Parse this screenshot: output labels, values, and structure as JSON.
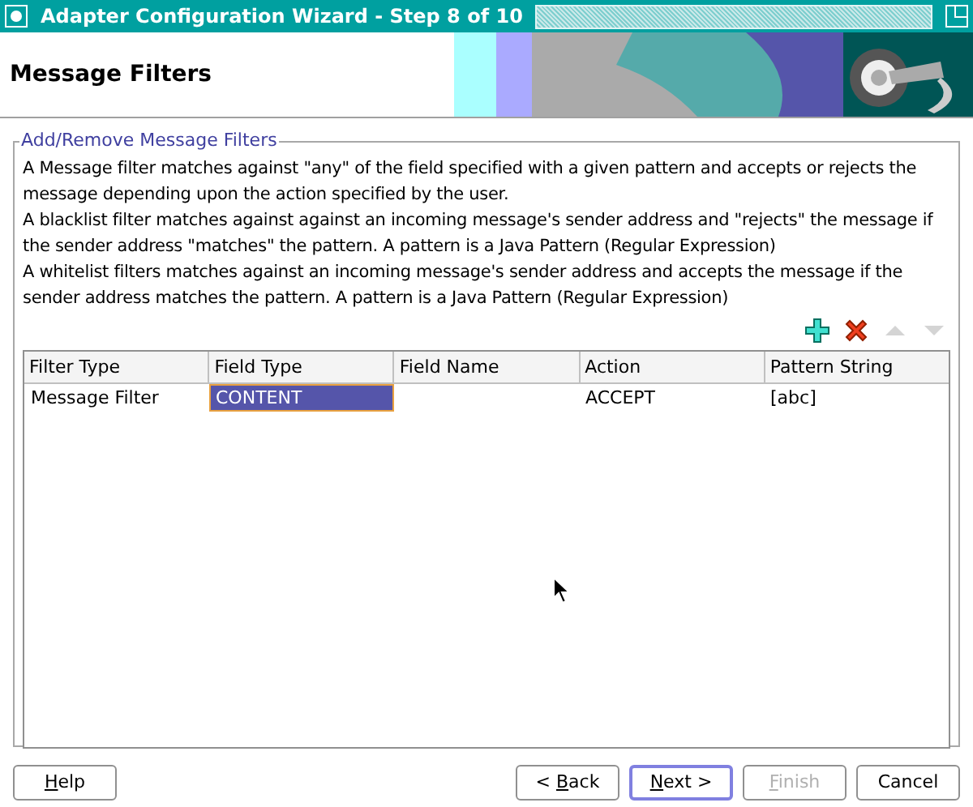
{
  "window": {
    "title": "Adapter Configuration Wizard - Step 8 of 10"
  },
  "header": {
    "title": "Message Filters"
  },
  "group": {
    "title": "Add/Remove Message Filters",
    "description": [
      "A Message filter matches against \"any\" of the field specified with a given pattern and accepts or rejects the message depending upon the action specified by the user.",
      "A blacklist filter matches against against an incoming message's sender address and \"rejects\" the message if the sender address \"matches\" the pattern. A pattern is a Java Pattern (Regular Expression)",
      "A whitelist filters matches against an incoming message's sender address and accepts the message if the sender address matches the pattern. A pattern is a Java Pattern (Regular Expression)"
    ],
    "toolbar": [
      {
        "kind": "add",
        "disabled": false
      },
      {
        "kind": "delete",
        "disabled": false
      },
      {
        "kind": "up",
        "disabled": true
      },
      {
        "kind": "down",
        "disabled": true
      }
    ],
    "table": {
      "columns": [
        "Filter Type",
        "Field Type",
        "Field Name",
        "Action",
        "Pattern String"
      ],
      "rows": [
        {
          "cells": [
            {
              "text": "Message Filter",
              "selected": false
            },
            {
              "text": "CONTENT",
              "selected": true
            },
            {
              "selected": false
            },
            {
              "text": "ACCEPT",
              "selected": false
            },
            {
              "text": "[abc]",
              "selected": false
            }
          ]
        }
      ]
    }
  },
  "buttons": [
    {
      "key": "H",
      "after": "elp",
      "disabled": false,
      "default": false
    },
    {
      "before": "< ",
      "key": "B",
      "after": "ack",
      "disabled": false,
      "default": false
    },
    {
      "key": "N",
      "after": "ext >",
      "disabled": false,
      "default": true
    },
    {
      "key": "F",
      "after": "inish",
      "disabled": true,
      "default": false
    },
    {
      "before": "Cancel",
      "disabled": false,
      "default": false
    }
  ]
}
